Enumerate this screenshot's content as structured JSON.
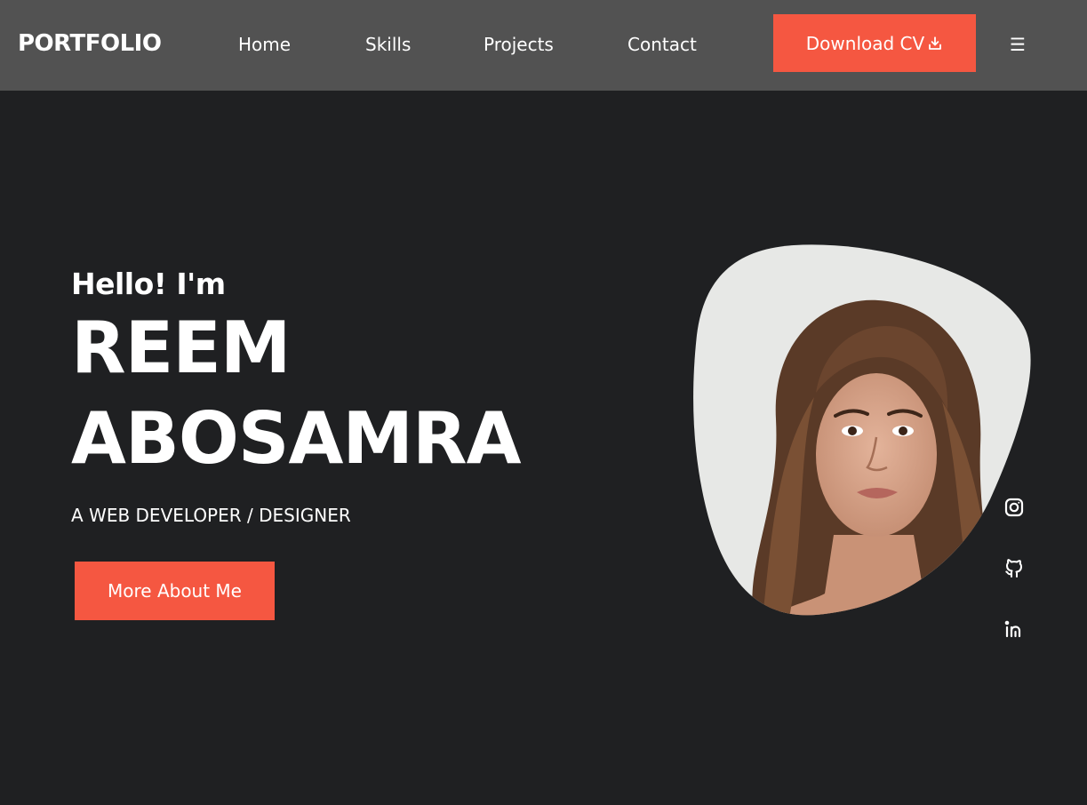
{
  "header": {
    "brand": "PORTFOLIO",
    "nav": [
      {
        "label": "Home"
      },
      {
        "label": "Skills"
      },
      {
        "label": "Projects"
      },
      {
        "label": "Contact"
      }
    ],
    "cta_label": "Download CV",
    "cta_icon": "download-icon",
    "menu_icon": "hamburger-menu-icon",
    "menu_glyph": "☰"
  },
  "hero": {
    "greeting": "Hello! I'm",
    "first_name": "REEM",
    "last_name": "ABOSAMRA",
    "role": "A WEB DEVELOPER / DESIGNER",
    "button_label": "More About Me",
    "portrait_icon": "profile-photo"
  },
  "social": [
    {
      "icon": "instagram-icon"
    },
    {
      "icon": "github-icon"
    },
    {
      "icon": "linkedin-icon"
    }
  ],
  "colors": {
    "accent": "#f55741",
    "navbar_bg": "#525252",
    "page_bg": "#1f2022",
    "text": "#ffffff"
  }
}
